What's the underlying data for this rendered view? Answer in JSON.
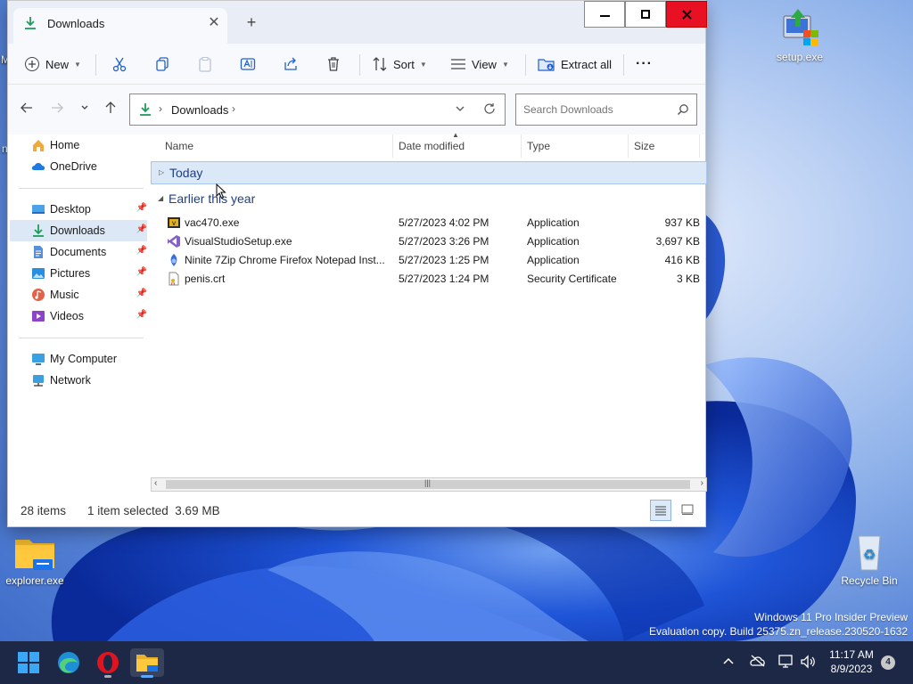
{
  "desktop": {
    "icons": [
      {
        "label": "setup.exe"
      },
      {
        "label": "explorer.exe"
      },
      {
        "label": "Recycle Bin"
      }
    ],
    "watermark": {
      "line1": "Windows 11 Pro Insider Preview",
      "line2": "Evaluation copy. Build 25375.zn_release.230520-1632"
    },
    "edge_letters": {
      "top": "M",
      "mid": "n"
    }
  },
  "window": {
    "tab_title": "Downloads",
    "tab_close": "✕",
    "new_tab": "+",
    "toolbar": {
      "new_label": "New",
      "sort_label": "Sort",
      "view_label": "View",
      "extract_label": "Extract all",
      "more_label": "···"
    },
    "address": {
      "crumb": "Downloads",
      "search_placeholder": "Search Downloads"
    },
    "sidebar": {
      "home": "Home",
      "onedrive": "OneDrive",
      "desktop": "Desktop",
      "downloads": "Downloads",
      "documents": "Documents",
      "pictures": "Pictures",
      "music": "Music",
      "videos": "Videos",
      "my_computer": "My Computer",
      "network": "Network"
    },
    "columns": {
      "name": "Name",
      "date": "Date modified",
      "type": "Type",
      "size": "Size"
    },
    "groups": {
      "today": "Today",
      "earlier": "Earlier this year"
    },
    "files": [
      {
        "name": "vac470.exe",
        "date": "5/27/2023 4:02 PM",
        "type": "Application",
        "size": "937 KB"
      },
      {
        "name": "VisualStudioSetup.exe",
        "date": "5/27/2023 3:26 PM",
        "type": "Application",
        "size": "3,697 KB"
      },
      {
        "name": "Ninite 7Zip Chrome Firefox Notepad Inst...",
        "date": "5/27/2023 1:25 PM",
        "type": "Application",
        "size": "416 KB"
      },
      {
        "name": "penis.crt",
        "date": "5/27/2023 1:24 PM",
        "type": "Security Certificate",
        "size": "3 KB"
      }
    ],
    "status": {
      "items": "28 items",
      "selected": "1 item selected  3.69 MB"
    }
  },
  "taskbar": {
    "time": "11:17 AM",
    "date": "8/9/2023",
    "notifications": "4"
  }
}
